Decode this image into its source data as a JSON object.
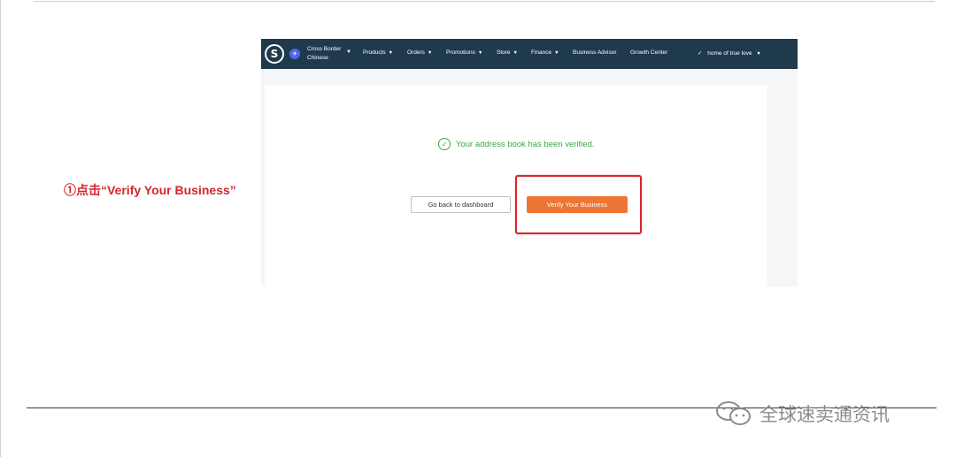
{
  "annotation": {
    "text": "①点击“Verify Your Business”"
  },
  "navbar": {
    "logo_letter": "S",
    "store_name_line1": "Cross Border",
    "store_name_line2": "Chinese",
    "items": [
      {
        "label": "Products",
        "caret": "▼"
      },
      {
        "label": "Orders",
        "caret": "▼"
      },
      {
        "label": "Promotions",
        "caret": "▼"
      },
      {
        "label": "Store",
        "caret": "▼"
      },
      {
        "label": "Finance",
        "caret": "▼"
      },
      {
        "label": "Business Advisor",
        "caret": ""
      },
      {
        "label": "Growth Center",
        "caret": ""
      }
    ],
    "user_check": "✓",
    "user_label": "home of true love",
    "user_caret": "▼",
    "background": "#1f3a4c"
  },
  "content": {
    "verified_message": "Your address book has been verified.",
    "check_icon": "check-circle-icon",
    "dashboard_button": "Go back to dashboard",
    "verify_button": "Verify Your Business",
    "accent_color": "#ef7534",
    "success_color": "#3aa54a"
  },
  "highlight": {
    "color": "#d5262e"
  },
  "watermark": {
    "text": "全球速卖通资讯",
    "icon": "wechat-icon"
  }
}
